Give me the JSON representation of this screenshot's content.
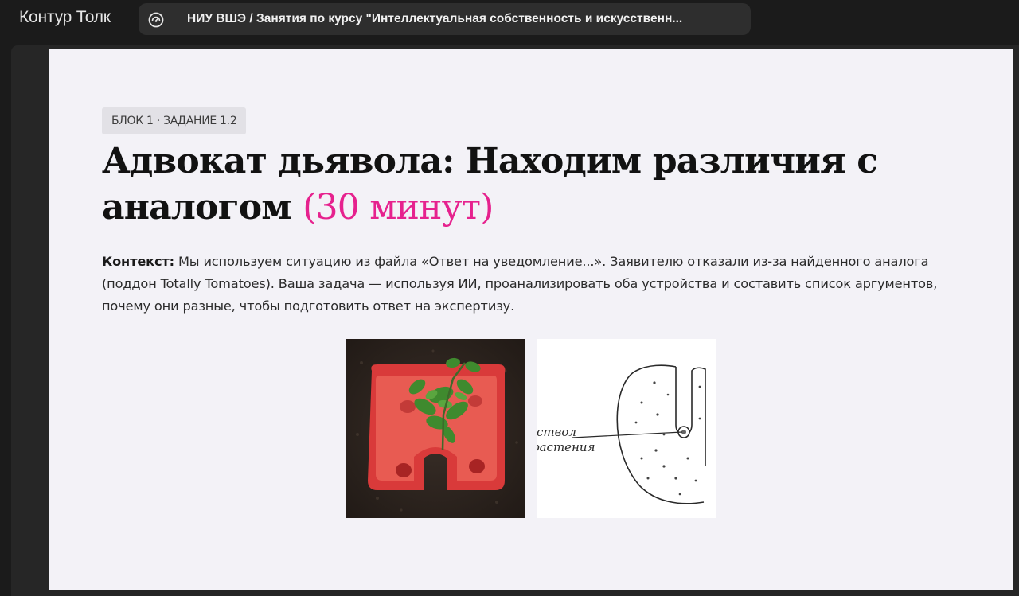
{
  "app": {
    "name": "Контур Толк"
  },
  "meeting": {
    "icon": "speedometer-icon",
    "title": "НИУ ВШЭ / Занятия по курсу \"Интеллектуальная собственность и искусственн..."
  },
  "slide": {
    "badge": "БЛОК 1 · ЗАДАНИЕ 1.2",
    "title_main": "Адвокат дьявола: Находим различия с аналогом ",
    "title_accent": "(30 минут)",
    "context_label": "Контекст:",
    "context_text": " Мы используем ситуацию из файла «Ответ на уведомление...». Заявителю отказали из-за найденного аналога (поддон Totally Tomatoes). Ваша задача — используя ИИ, проанализировать оба устройства и составить список аргументов, почему они разные, чтобы подготовить ответ на экспертизу.",
    "drawing_label_1": "ствол",
    "drawing_label_2": "растения",
    "accent_color": "#e6228e"
  }
}
